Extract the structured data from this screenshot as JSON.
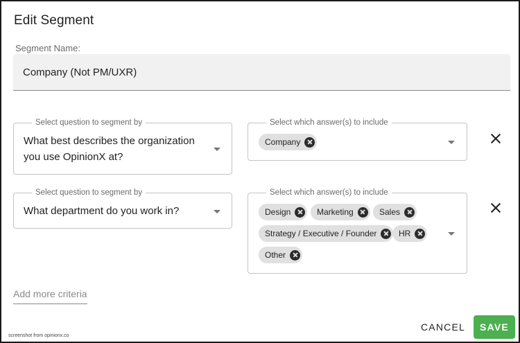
{
  "dialog": {
    "title": "Edit Segment",
    "segment_name_label": "Segment Name:",
    "segment_name_value": "Company (Not PM/UXR)"
  },
  "criteria": [
    {
      "question_legend": "Select question to segment by",
      "question_line1": "What best describes the organization",
      "question_line2": "you use OpinionX at?",
      "answers_legend": "Select which answer(s) to include",
      "answers": [
        "Company"
      ]
    },
    {
      "question_legend": "Select question to segment by",
      "question_line1": "What department do you work in?",
      "answers_legend": "Select which answer(s) to include",
      "answers": [
        "Design",
        "Marketing",
        "Sales",
        "Strategy / Executive / Founder",
        "HR",
        "Other"
      ]
    }
  ],
  "add_more_label": "Add more criteria",
  "footer": {
    "cancel_label": "CANCEL",
    "save_label": "SAVE",
    "save_color": "#4caf50"
  },
  "watermark": "screenshot from opinionx.co",
  "icons": {
    "dropdown": "caret-down-icon",
    "chip_remove": "cancel-circle-icon",
    "row_remove": "close-icon"
  }
}
